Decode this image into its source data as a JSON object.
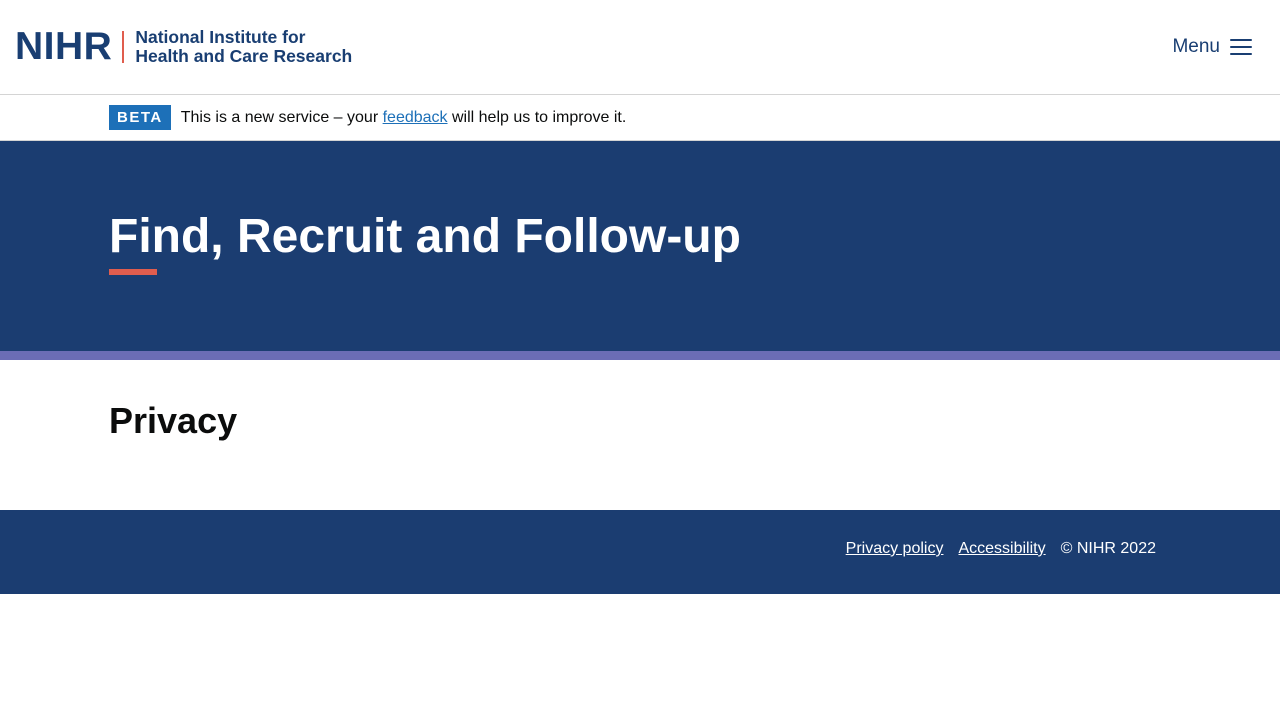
{
  "header": {
    "logo": {
      "acronym": "NIHR",
      "line1": "National Institute for",
      "line2": "Health and Care Research"
    },
    "menu_label": "Menu",
    "menu_icon": "hamburger-icon"
  },
  "beta_banner": {
    "tag": "BETA",
    "text_before": "This is a new service – your",
    "link_text": "feedback",
    "text_after": "will help us to improve it."
  },
  "hero": {
    "title": "Find, Recruit and Follow-up"
  },
  "main": {
    "heading": "Privacy"
  },
  "footer": {
    "links": [
      "Privacy policy",
      "Accessibility"
    ],
    "copyright": "© NIHR 2022"
  },
  "colors": {
    "brand_navy": "#1b3d71",
    "accent_red": "#e05d4e",
    "accent_purple": "#6b6db5",
    "link_blue": "#1d70b8"
  }
}
